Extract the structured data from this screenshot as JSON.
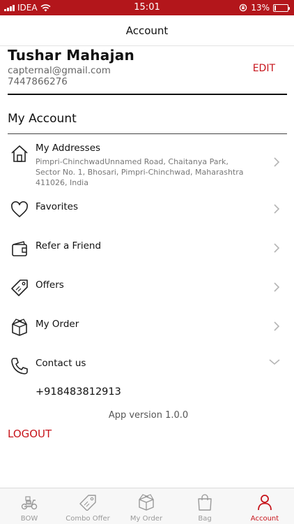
{
  "status_bar": {
    "carrier": "IDEA",
    "time": "15:01",
    "battery": "13%",
    "battery_level": 0.13
  },
  "header": {
    "title": "Account"
  },
  "profile": {
    "name": "Tushar Mahajan",
    "email": "capternal@gmail.com",
    "phone": "7447866276",
    "edit_label": "EDIT"
  },
  "section": {
    "title": "My Account"
  },
  "menu": {
    "addresses": {
      "label": "My Addresses",
      "subtitle": "Pimpri-ChinchwadUnnamed Road, Chaitanya Park, Sector No. 1, Bhosari, Pimpri-Chinchwad, Maharashtra 411026, India",
      "icon": "home-icon"
    },
    "favorites": {
      "label": "Favorites",
      "icon": "heart-icon"
    },
    "refer": {
      "label": "Refer a Friend",
      "icon": "wallet-icon"
    },
    "offers": {
      "label": "Offers",
      "icon": "tag-icon"
    },
    "orders": {
      "label": "My Order",
      "icon": "box-icon"
    },
    "contact": {
      "label": "Contact us",
      "icon": "phone-icon",
      "expanded": true
    }
  },
  "contact_number": "+918483812913",
  "app_version": "App version 1.0.0",
  "logout_label": "LOGOUT",
  "tabs": [
    {
      "label": "BOW",
      "icon": "scooter-icon",
      "active": false
    },
    {
      "label": "Combo Offer",
      "icon": "tag-icon",
      "active": false
    },
    {
      "label": "My Order",
      "icon": "box-icon",
      "active": false
    },
    {
      "label": "Bag",
      "icon": "bag-icon",
      "active": false
    },
    {
      "label": "Account",
      "icon": "person-icon",
      "active": true
    }
  ],
  "colors": {
    "accent": "#c7141b",
    "status_bar": "#b3161b",
    "inactive_tab": "#999999"
  }
}
